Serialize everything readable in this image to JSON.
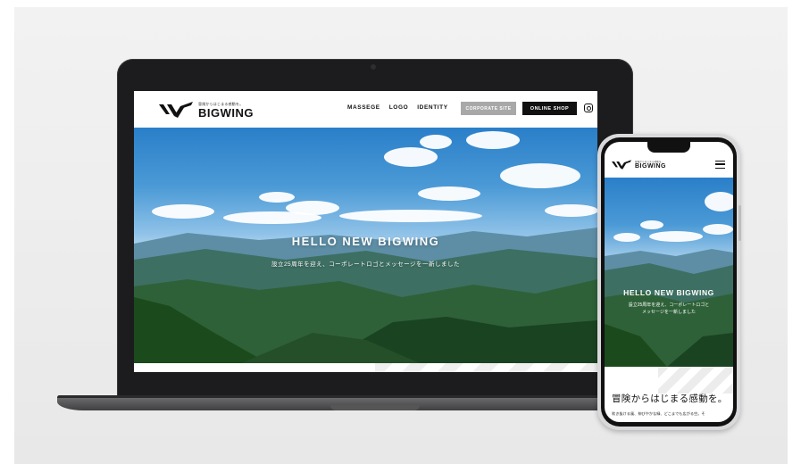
{
  "site": {
    "brand_tagline": "冒険からはじまる感動を。",
    "brand_name": "BIGWING",
    "nav": [
      "MASSEGE",
      "LOGO",
      "IDENTITY"
    ],
    "corporate_site_label": "CORPORATE SITE",
    "online_shop_label": "ONLINE SHOP",
    "hero_title": "HELLO NEW BIGWING",
    "hero_subtitle": "設立25周年を迎え、コーポレートロゴとメッセージを一新しました"
  },
  "phone": {
    "brand_tagline": "冒険からはじまる感動を。",
    "brand_name": "BIGWING",
    "hero_title": "HELLO NEW BIGWING",
    "hero_subtitle_line1": "設立25周年を迎え、コーポレートロゴと",
    "hero_subtitle_line2": "メッセージを一新しました",
    "section_heading": "冒険からはじまる感動を。",
    "section_body": "吹き抜ける風、伸びやかな緑、どこまでも広がる空。そ"
  },
  "icons": {
    "instagram": "instagram-icon",
    "menu": "hamburger-menu-icon",
    "logo": "bigwing-logo-mark"
  },
  "colors": {
    "accent_dark": "#111111",
    "corporate_button": "#a8a8a8",
    "sky": "#4b9ad6",
    "forest": "#1f4a24"
  }
}
